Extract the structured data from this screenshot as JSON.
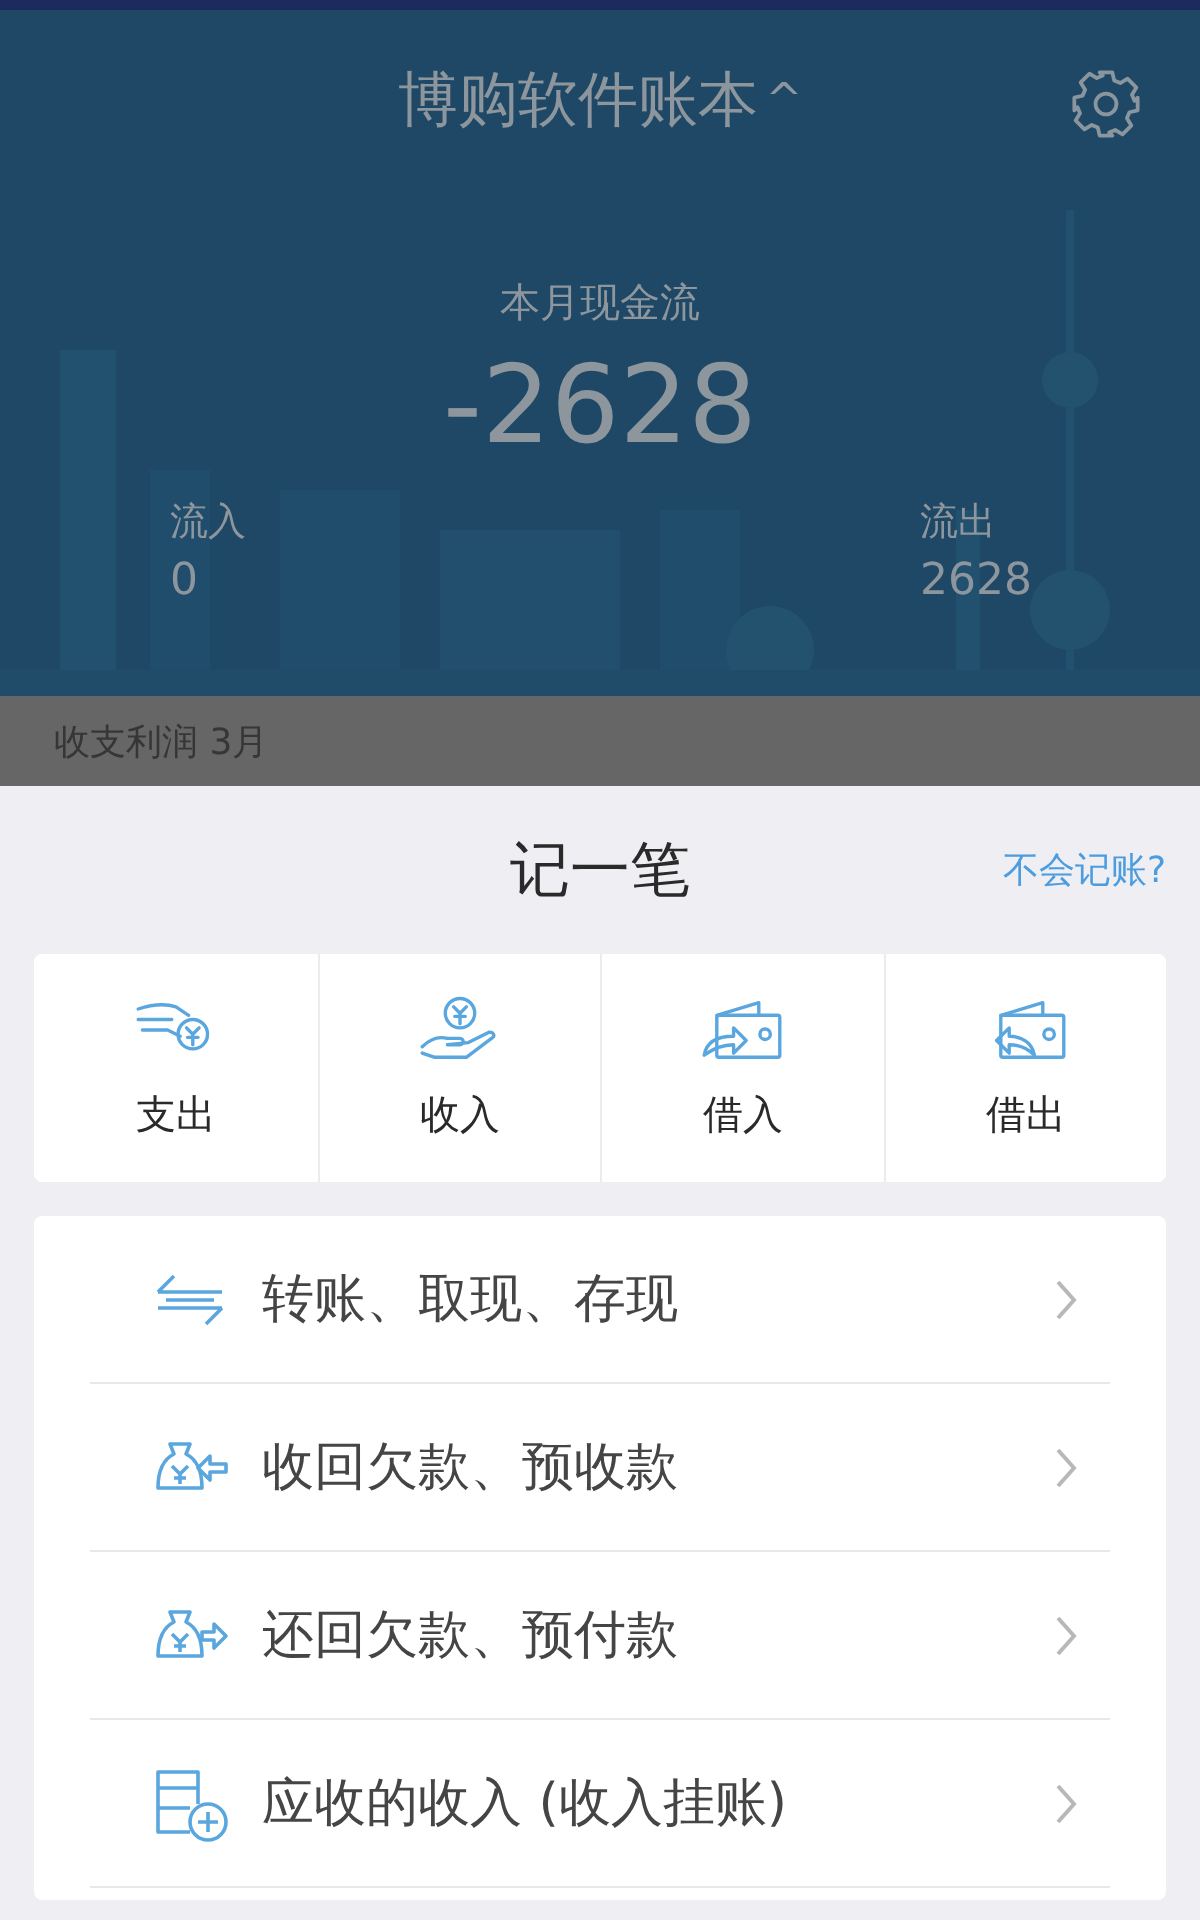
{
  "header": {
    "title": "博购软件账本",
    "title_caret": "^",
    "cash_flow_label": "本月现金流",
    "cash_flow_value": "-2628",
    "inflow_label": "流入",
    "inflow_value": "0",
    "outflow_label": "流出",
    "outflow_value": "2628"
  },
  "section_bar": {
    "label": "收支利润 3月"
  },
  "sheet": {
    "title": "记一笔",
    "help_link": "不会记账?",
    "quick_actions": [
      {
        "label": "支出"
      },
      {
        "label": "收入"
      },
      {
        "label": "借入"
      },
      {
        "label": "借出"
      }
    ],
    "menu_items": [
      {
        "label": "转账、取现、存现"
      },
      {
        "label": "收回欠款、预收款"
      },
      {
        "label": "还回欠款、预付款"
      },
      {
        "label": "应收的收入 (收入挂账)"
      }
    ]
  }
}
